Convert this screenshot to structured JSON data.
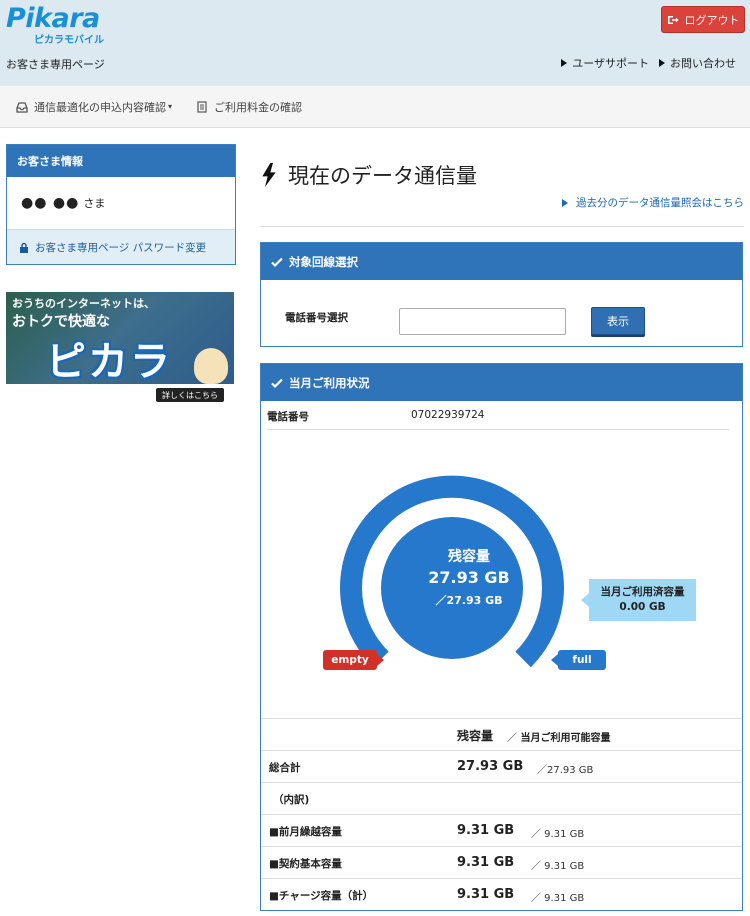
{
  "header": {
    "logo_text": "Pikara",
    "logo_sub": "ピカラモバイル",
    "page_label": "お客さま専用ページ",
    "logout_label": "ログアウト",
    "links": [
      "ユーザサポート",
      "お問い合わせ"
    ]
  },
  "nav": {
    "items": [
      {
        "label": "通信最適化の申込内容確認",
        "icon": "inbox-icon"
      },
      {
        "label": "ご利用料金の確認",
        "icon": "document-icon"
      }
    ]
  },
  "sidebar": {
    "heading": "お客さま情報",
    "user_mask": "●● ●●",
    "user_suffix": "さま",
    "password_link": "お客さま専用ページ パスワード変更",
    "banner": {
      "line1": "おうちのインターネットは、",
      "line2": "おトクで快適な",
      "brand": "ピカラ",
      "button": "詳しくはこちら"
    }
  },
  "main": {
    "title": "現在のデータ通信量",
    "past_link": "過去分のデータ通信量照会はこちら",
    "line_select": {
      "heading": "対象回線選択",
      "label": "電話番号選択",
      "input_value": "",
      "button": "表示"
    },
    "usage": {
      "heading": "当月ご利用状況",
      "tel_label": "電話番号",
      "tel_value": "07022939724",
      "gauge": {
        "remain_label": "残容量",
        "remain_value": "27.93 GB",
        "remain_total": "／27.93 GB",
        "used_label": "当月ご利用済容量",
        "used_value": "0.00 GB",
        "empty_label": "empty",
        "full_label": "full",
        "remaining_fraction": 1.0
      },
      "table": {
        "col_remain": "残容量",
        "col_sep": "／",
        "col_available": "当月ご利用可能容量",
        "rows": [
          {
            "label": "総合計",
            "value": "27.93 GB",
            "total": "／27.93 GB"
          },
          {
            "label": "（内訳)",
            "value": "",
            "total": ""
          },
          {
            "label": "■前月繰越容量",
            "value": "9.31 GB",
            "total": "／ 9.31 GB"
          },
          {
            "label": "■契約基本容量",
            "value": "9.31 GB",
            "total": "／ 9.31 GB"
          },
          {
            "label": "■チャージ容量（計）",
            "value": "9.31 GB",
            "total": "／ 9.31 GB"
          }
        ]
      }
    }
  },
  "colors": {
    "primary": "#2f73b8",
    "logout": "#d9433b",
    "gauge": "#2578cc",
    "empty": "#d2312a",
    "used_box": "#9fd8f5"
  }
}
